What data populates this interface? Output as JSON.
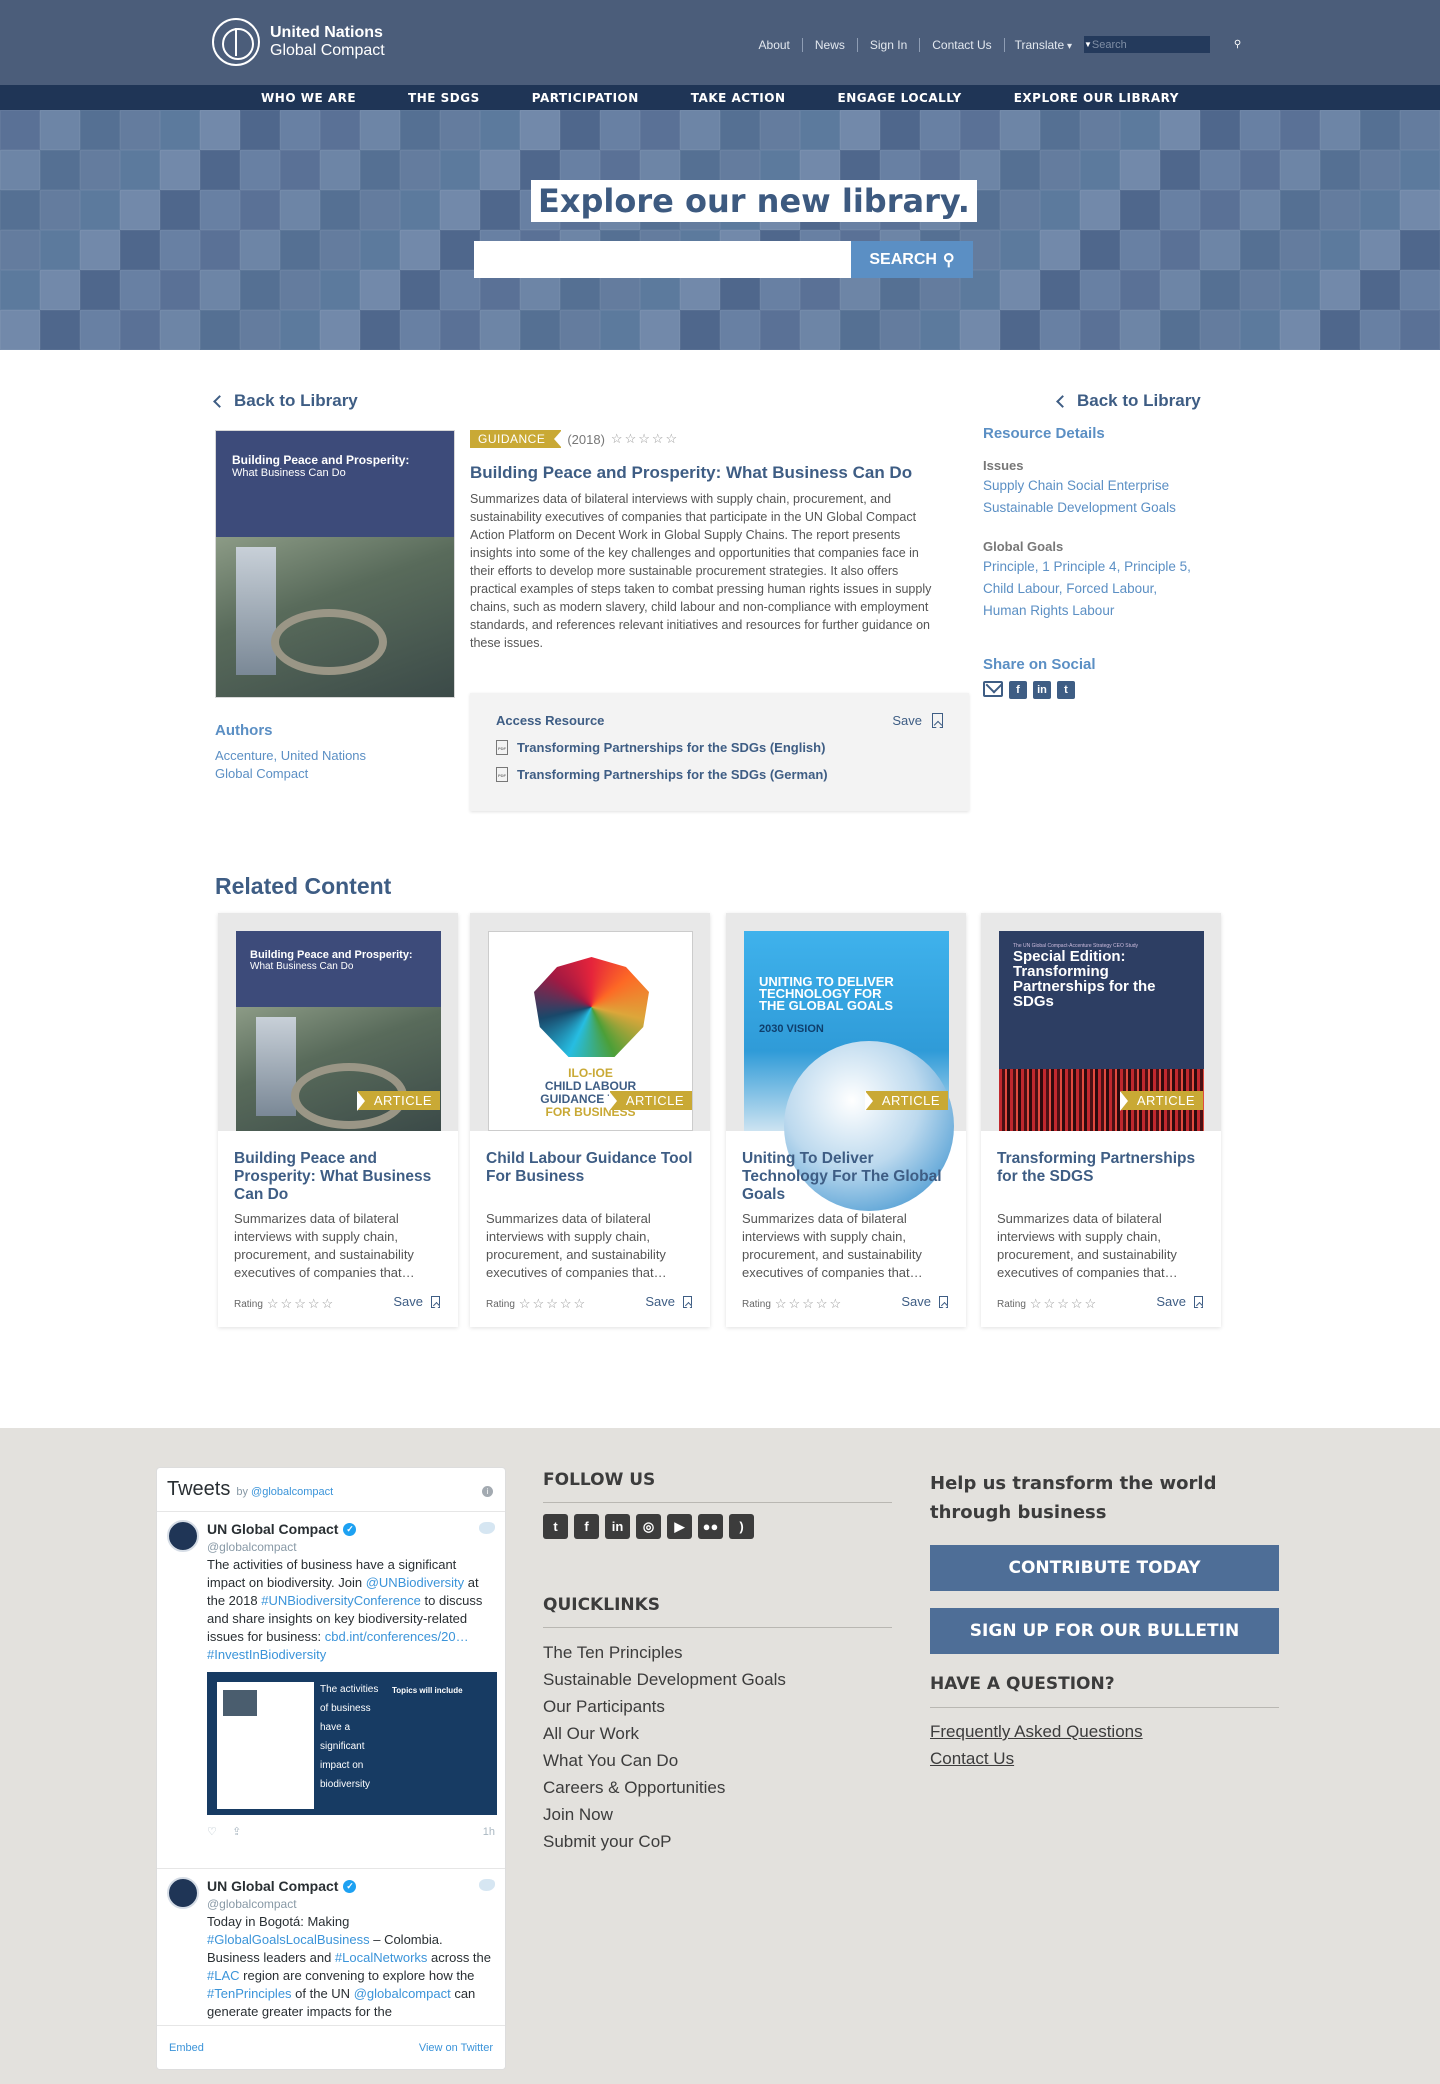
{
  "header": {
    "logo_line1": "United Nations",
    "logo_line2": "Global Compact",
    "utility_links": [
      "About",
      "News",
      "Sign In",
      "Contact Us"
    ],
    "translate": "Translate",
    "search_placeholder": "Search"
  },
  "nav": [
    "WHO WE ARE",
    "THE SDGS",
    "PARTICIPATION",
    "TAKE ACTION",
    "ENGAGE LOCALLY",
    "EXPLORE OUR LIBRARY"
  ],
  "hero": {
    "title": "Explore our new library.",
    "search_button": "SEARCH"
  },
  "back_label": "Back to Library",
  "resource": {
    "cover_title": "Building Peace and Prosperity:",
    "cover_subtitle": "What Business Can Do",
    "tag": "GUIDANCE",
    "year": "(2018)",
    "stars": "☆☆☆☆☆",
    "title": "Building Peace and Prosperity: What Business Can Do",
    "description": "Summarizes data of bilateral interviews with supply chain, procurement, and sustainability executives of companies that participate in the UN Global Compact Action Platform on Decent Work in Global Supply Chains. The report presents insights into some of the key challenges and opportunities that companies face in their efforts to develop more sustainable procurement strategies. It also offers practical examples of steps taken to combat pressing human rights issues in supply chains, such as modern slavery, child labour and non-compliance with employment standards, and references relevant initiatives and resources for further guidance on these issues.",
    "authors_heading": "Authors",
    "authors": "Accenture, United Nations Global Compact",
    "access_heading": "Access Resource",
    "save": "Save",
    "files": [
      "Transforming Partnerships for the SDGs (English)",
      "Transforming Partnerships for the SDGs (German)"
    ]
  },
  "details": {
    "heading": "Resource Details",
    "issues_heading": "Issues",
    "issues": [
      "Supply Chain Social Enterprise",
      "Sustainable Development Goals"
    ],
    "goals_heading": "Global Goals",
    "goals": [
      "Principle, 1 Principle 4, Principle 5,",
      "Child Labour, Forced Labour,",
      "Human Rights Labour"
    ],
    "share_heading": "Share on Social"
  },
  "related": {
    "heading": "Related Content",
    "rating_label": "Rating",
    "save": "Save",
    "tag": "ARTICLE",
    "cards": [
      {
        "title": "Building Peace and Prosperity: What Business Can Do",
        "desc": "Summarizes data of bilateral interviews with supply chain, procurement, and sustainability executives of companies that…"
      },
      {
        "title": "Child Labour Guidance Tool For Business",
        "desc": "Summarizes data of bilateral interviews with supply chain, procurement, and sustainability executives of companies that…"
      },
      {
        "title": "Uniting To Deliver Technology For The Global Goals",
        "desc": "Summarizes data of bilateral interviews with supply chain, procurement, and sustainability executives of companies that…"
      },
      {
        "title": "Transforming Partnerships for the SDGS",
        "desc": "Summarizes data of bilateral interviews with supply chain, procurement, and sustainability executives of companies that…"
      }
    ],
    "ilo_line1": "ILO-IOE",
    "ilo_line2": "CHILD LABOUR",
    "ilo_line3": "GUIDANCE TOOL",
    "ilo_line4": "FOR BUSINESS",
    "uniting_cover": "UNITING TO DELIVER TECHNOLOGY FOR THE GLOBAL GOALS",
    "uniting_sub": "2030 VISION",
    "transforming_small": "The UN Global Compact-Accenture Strategy CEO Study",
    "transforming_cover": "Special Edition: Transforming Partnerships for the SDGs"
  },
  "footer": {
    "tweets_title": "Tweets",
    "tweets_by": "by",
    "tweets_handle_link": "@globalcompact",
    "tweet1": {
      "name": "UN Global Compact",
      "handle": "@globalcompact",
      "text_a": "The activities of business have a significant impact on biodiversity. Join ",
      "mention": "@UNBiodiversity",
      "text_b": " at the 2018 ",
      "hashtag": "#UNBiodiversityConference",
      "text_c": " to discuss and share insights on key biodiversity-related issues for business: ",
      "link": "cbd.int/conferences/20…",
      "hashtag2": "#InvestInBiodiversity",
      "image_text": "The activities of business have a significant impact on biodiversity",
      "image_topics": "Topics will include",
      "time": "1h"
    },
    "tweet2": {
      "name": "UN Global Compact",
      "handle": "@globalcompact",
      "text_a": "Today in Bogotá: Making ",
      "h1": "#GlobalGoalsLocalBusiness",
      "text_b": " – Colombia. Business leaders and ",
      "h2": "#LocalNetworks",
      "text_c": " across the ",
      "h3": "#LAC",
      "text_d": " region are convening to explore how the ",
      "h4": "#TenPrinciples",
      "text_e": " of the UN ",
      "h5": "@globalcompact",
      "text_f": " can generate greater impacts for the"
    },
    "embed": "Embed",
    "view_on_twitter": "View on Twitter",
    "follow_heading": "FOLLOW US",
    "quicklinks_heading": "QUICKLINKS",
    "quicklinks": [
      "The Ten Principles",
      "Sustainable Development Goals",
      "Our Participants",
      "All Our Work",
      "What You Can Do",
      "Careers & Opportunities",
      "Join Now",
      "Submit your CoP"
    ],
    "help_heading": "Help us transform the world through business",
    "contribute": "CONTRIBUTE TODAY",
    "signup": "SIGN UP FOR OUR BULLETIN",
    "question_heading": "HAVE A QUESTION?",
    "faq": "Frequently Asked Questions",
    "contact": "Contact Us"
  }
}
